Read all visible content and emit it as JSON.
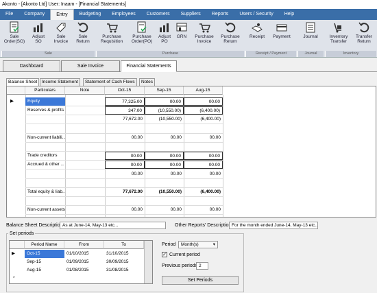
{
  "app": {
    "title": "Akonto - [Akonto Ltd]  User: Inaam - [Financial Statements]"
  },
  "menu": [
    "File",
    "Company",
    "Entry",
    "Budgeting",
    "Employees",
    "Customers",
    "Suppliers",
    "Reports",
    "Users / Security",
    "Help"
  ],
  "ribbon": {
    "buttons": [
      {
        "label1": "Sale",
        "label2": "Order(SO)",
        "icon": "sale-order-icon"
      },
      {
        "label1": "Adjust",
        "label2": "SO",
        "icon": "adjust-icon"
      },
      {
        "label1": "Sale",
        "label2": "Invoice",
        "icon": "invoice-tag-icon"
      },
      {
        "label1": "Sale",
        "label2": "Return",
        "icon": "return-arrow-icon"
      },
      {
        "label1": "Purchase",
        "label2": "Requisition",
        "icon": "cart-icon"
      },
      {
        "label1": "Purchase",
        "label2": "Order(PO)",
        "icon": "purchase-order-icon"
      },
      {
        "label1": "Adjust",
        "label2": "PO",
        "icon": "adjust-icon"
      },
      {
        "label1": "GRN",
        "label2": "",
        "icon": "grn-icon"
      },
      {
        "label1": "Purchase",
        "label2": "Invoice",
        "icon": "cart-icon"
      },
      {
        "label1": "Purchase",
        "label2": "Return",
        "icon": "return-arrow-icon"
      },
      {
        "label1": "Receipt",
        "label2": "",
        "icon": "receipt-icon"
      },
      {
        "label1": "Payment",
        "label2": "",
        "icon": "payment-icon"
      },
      {
        "label1": "Journal",
        "label2": "",
        "icon": "journal-icon"
      },
      {
        "label1": "Inventory",
        "label2": "Transfer",
        "icon": "inventory-transfer-icon"
      },
      {
        "label1": "Transfer",
        "label2": "Return",
        "icon": "return-arrow-icon"
      }
    ],
    "groups": [
      "Sale",
      "Purchase",
      "Receipt / Payment",
      "Journal",
      "Inventory"
    ]
  },
  "doc_tabs": [
    "Dashboard",
    "Sale Invoice",
    "Financial Statements"
  ],
  "sub_tabs": [
    "Balance Sheet",
    "Income Statement",
    "Statement of Cash Flows",
    "Notes"
  ],
  "grid": {
    "headers": [
      "Particulars",
      "Note",
      "Oct-15",
      "Sep-15",
      "Aug-15"
    ],
    "rows": [
      {
        "p": "Equity",
        "n": "",
        "c1": "77,325.00",
        "c2": "00.00",
        "c3": "00.00"
      },
      {
        "p": "Reserves & profits",
        "n": "",
        "c1": "347.00",
        "c2": "(10,550.00)",
        "c3": "(6,400.00)"
      },
      {
        "p": "",
        "n": "",
        "c1": "77,672.00",
        "c2": "(10,550.00)",
        "c3": "(6,400.00)"
      },
      {
        "p": "",
        "n": "",
        "c1": "",
        "c2": "",
        "c3": ""
      },
      {
        "p": "Non-current liabili...",
        "n": "",
        "c1": "00.00",
        "c2": "00.00",
        "c3": "00.00"
      },
      {
        "p": "",
        "n": "",
        "c1": "",
        "c2": "",
        "c3": ""
      },
      {
        "p": "Trade creditors",
        "n": "",
        "c1": "00.00",
        "c2": "00.00",
        "c3": "00.00"
      },
      {
        "p": "Accrued & other ...",
        "n": "",
        "c1": "00.00",
        "c2": "00.00",
        "c3": "00.00"
      },
      {
        "p": "",
        "n": "",
        "c1": "00.00",
        "c2": "00.00",
        "c3": "00.00"
      },
      {
        "p": "",
        "n": "",
        "c1": "",
        "c2": "",
        "c3": ""
      },
      {
        "p": "Total equity & liab...",
        "n": "",
        "c1": "77,672.00",
        "c2": "(10,550.00)",
        "c3": "(6,400.00)"
      },
      {
        "p": "",
        "n": "",
        "c1": "",
        "c2": "",
        "c3": ""
      },
      {
        "p": "Non-current assets",
        "n": "",
        "c1": "00.00",
        "c2": "00.00",
        "c3": "00.00"
      }
    ]
  },
  "descriptions": {
    "bs_label": "Balance Sheet Description:",
    "bs_value": "As at June-14, May-13 etc...",
    "other_label": "Other Reports' Description:",
    "other_value": "For the month ended June-14, May-13 etc..."
  },
  "periods": {
    "title": "Set periods",
    "headers": [
      "Period Name",
      "From",
      "To"
    ],
    "rows": [
      {
        "name": "Oct-15",
        "from": "01/10/2015",
        "to": "31/10/2015"
      },
      {
        "name": "Sep-15",
        "from": "01/09/2015",
        "to": "30/09/2015"
      },
      {
        "name": "Aug-15",
        "from": "01/08/2015",
        "to": "31/08/2015"
      }
    ],
    "new_row_marker": "*",
    "current_marker": "▶",
    "period_label": "Period",
    "period_value": "Month(s)",
    "current_period_label": "Current period",
    "previous_label": "Previous periods",
    "previous_value": "2",
    "set_button": "Set Periods"
  }
}
